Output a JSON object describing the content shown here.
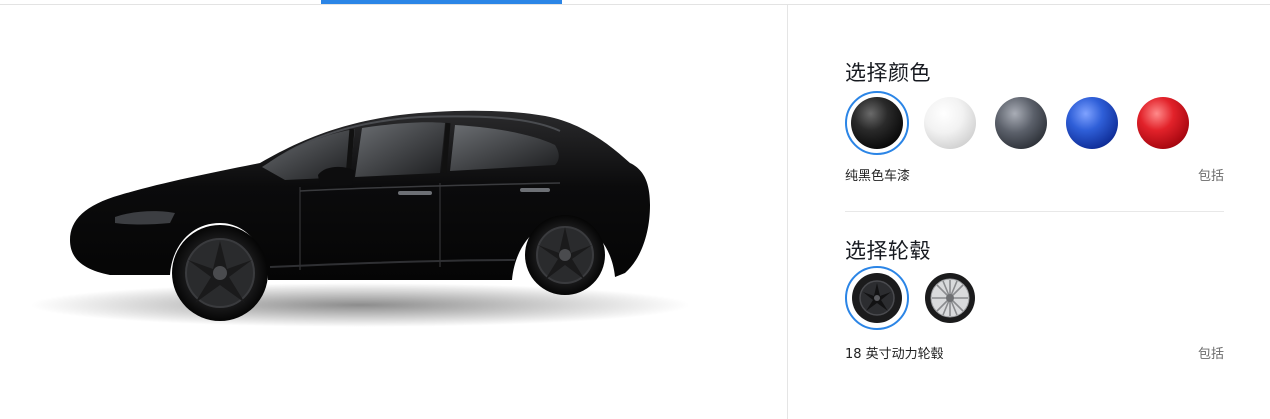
{
  "colors": {
    "accent": "#2b85e6",
    "paint_black": "#1a1a1a",
    "paint_white": "#f0f0f0",
    "paint_grey": "#4b4f58",
    "paint_blue": "#1d46b8",
    "paint_red": "#c8101a"
  },
  "paint_section": {
    "title": "选择颜色",
    "options": [
      {
        "icon": "black-paint-swatch-icon"
      },
      {
        "icon": "white-paint-swatch-icon"
      },
      {
        "icon": "grey-paint-swatch-icon"
      },
      {
        "icon": "blue-paint-swatch-icon"
      },
      {
        "icon": "red-paint-swatch-icon"
      }
    ],
    "selected_name": "纯黑色车漆",
    "selected_price": "包括"
  },
  "wheel_section": {
    "title": "选择轮毂",
    "options": [
      {
        "icon": "aero-wheel-icon"
      },
      {
        "icon": "sport-wheel-icon"
      }
    ],
    "selected_name": "18 英寸动力轮毂",
    "selected_price": "包括"
  }
}
